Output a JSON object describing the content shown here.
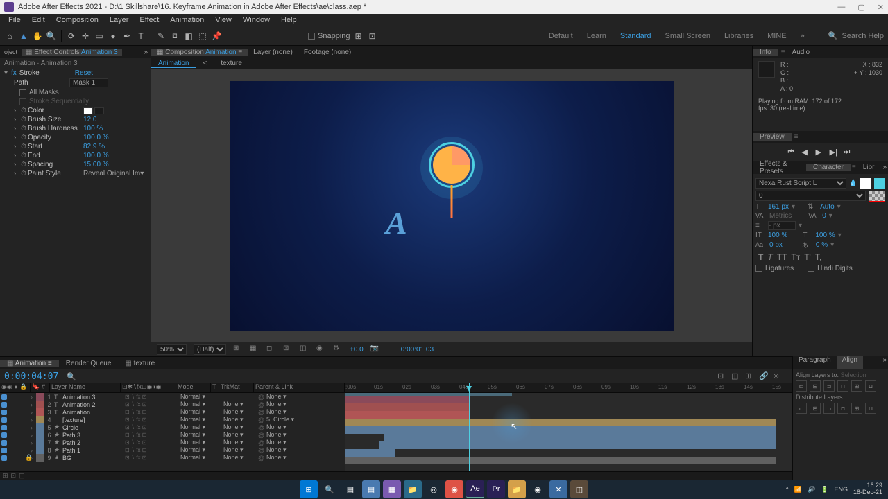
{
  "titlebar": {
    "text": "Adobe After Effects 2021 - D:\\1 Skillshare\\16. Keyframe Animation in Adobe After Effects\\ae\\class.aep *"
  },
  "menu": [
    "File",
    "Edit",
    "Composition",
    "Layer",
    "Effect",
    "Animation",
    "View",
    "Window",
    "Help"
  ],
  "toolbar": {
    "snapping": "Snapping"
  },
  "workspaces": [
    "Default",
    "Learn",
    "Standard",
    "Small Screen",
    "Libraries",
    "MINE"
  ],
  "workspace_active": "Standard",
  "search_help": "Search Help",
  "effect_controls": {
    "tab_prefix": "Effect Controls",
    "tab_name": "Animation 3",
    "breadcrumb": "Animation · Animation 3",
    "fx_name": "Stroke",
    "reset": "Reset",
    "path_label": "Path",
    "path_value": "Mask 1",
    "all_masks": "All Masks",
    "stroke_seq": "Stroke Sequentially",
    "props": [
      {
        "name": "Color",
        "val": ""
      },
      {
        "name": "Brush Size",
        "val": "12.0"
      },
      {
        "name": "Brush Hardness",
        "val": "100 %"
      },
      {
        "name": "Opacity",
        "val": "100.0 %"
      },
      {
        "name": "Start",
        "val": "82.9 %"
      },
      {
        "name": "End",
        "val": "100.0 %"
      },
      {
        "name": "Spacing",
        "val": "15.00 %"
      },
      {
        "name": "Paint Style",
        "val": "Reveal Original Im"
      }
    ]
  },
  "comp": {
    "tab_label": "Composition",
    "tab_name": "Animation",
    "layer_tab": "Layer (none)",
    "footage_tab": "Footage (none)",
    "subtabs": [
      "Animation",
      "texture"
    ],
    "subtab_active": "Animation"
  },
  "viewport_footer": {
    "zoom": "50%",
    "res": "(Half)",
    "exposure": "+0.0",
    "timecode": "0:00:01:03"
  },
  "info": {
    "tab1": "Info",
    "tab2": "Audio",
    "r": "R :",
    "g": "G :",
    "b": "B :",
    "a": "A : 0",
    "x": "X : 832",
    "y": "Y : 1030",
    "msg1": "Playing from RAM: 172 of 172",
    "msg2": "fps: 30 (realtime)"
  },
  "preview": {
    "tab": "Preview"
  },
  "effects_presets": {
    "tab1": "Effects & Presets",
    "tab2": "Character",
    "tab3": "Libr"
  },
  "character": {
    "font": "Nexa Rust Script L",
    "style": "0",
    "size": "161 px",
    "leading": "Auto",
    "kerning": "Metrics",
    "tracking": "0",
    "stroke_placeholder": "- px",
    "vscale": "100 %",
    "hscale": "100 %",
    "baseline": "0 px",
    "tsume": "0 %",
    "ligatures": "Ligatures",
    "hindi": "Hindi Digits"
  },
  "timeline": {
    "tabs": [
      "Animation",
      "Render Queue",
      "texture"
    ],
    "tab_active": "Animation",
    "timecode": "0:00:04:07",
    "cols": {
      "layername": "Layer Name",
      "mode": "Mode",
      "t": "T",
      "trkmat": "TrkMat",
      "parent": "Parent & Link"
    },
    "ruler": [
      ":00s",
      "01s",
      "02s",
      "03s",
      "04s",
      "05s",
      "06s",
      "07s",
      "08s",
      "09s",
      "10s",
      "11s",
      "12s",
      "13s",
      "14s",
      "15s"
    ],
    "layers": [
      {
        "num": "1",
        "type": "T",
        "name": "Animation 3",
        "color": "#8a4a5a",
        "mode": "Normal",
        "trkmat": "",
        "parent": "None",
        "bar_color": "#8a4a5a",
        "start": 0,
        "end": 180
      },
      {
        "num": "2",
        "type": "T",
        "name": "Animation 2",
        "color": "#a05050",
        "mode": "Normal",
        "trkmat": "None",
        "parent": "None",
        "bar_color": "#a05050",
        "start": 0,
        "end": 180
      },
      {
        "num": "3",
        "type": "T",
        "name": "Animation",
        "color": "#b05555",
        "mode": "Normal",
        "trkmat": "None",
        "parent": "None",
        "bar_color": "#b05555",
        "start": 0,
        "end": 180
      },
      {
        "num": "4",
        "type": "",
        "name": "[texture]",
        "color": "#a08855",
        "mode": "Normal",
        "trkmat": "None",
        "parent": "5. Circle",
        "bar_color": "#a08855",
        "start": 0,
        "end": 620
      },
      {
        "num": "5",
        "type": "★",
        "name": "Circle",
        "color": "#5a7a9a",
        "mode": "Normal",
        "trkmat": "None",
        "parent": "None",
        "bar_color": "#5a7a9a",
        "start": 0,
        "end": 620
      },
      {
        "num": "6",
        "type": "★",
        "name": "Path 3",
        "color": "#5a7a9a",
        "mode": "Normal",
        "trkmat": "None",
        "parent": "None",
        "bar_color": "#5a7a9a",
        "start": 55,
        "end": 620
      },
      {
        "num": "7",
        "type": "★",
        "name": "Path 2",
        "color": "#5a7a9a",
        "mode": "Normal",
        "trkmat": "None",
        "parent": "None",
        "bar_color": "#5a7a9a",
        "start": 48,
        "end": 620
      },
      {
        "num": "8",
        "type": "★",
        "name": "Path 1",
        "color": "#5a7a9a",
        "mode": "Normal",
        "trkmat": "None",
        "parent": "None",
        "bar_color": "#5a7a9a",
        "start": 0,
        "end": 72
      },
      {
        "num": "9",
        "type": "★",
        "name": "BG",
        "color": "#606060",
        "mode": "Normal",
        "trkmat": "None",
        "parent": "None",
        "bar_color": "#606060",
        "start": 0,
        "end": 620
      }
    ]
  },
  "align": {
    "tab1": "Paragraph",
    "tab2": "Align",
    "label": "Align Layers to:",
    "sel": "Selection",
    "distribute": "Distribute Layers:"
  },
  "taskbar": {
    "time": "16:29",
    "date": "18-Dec-21",
    "lang": "ENG"
  }
}
